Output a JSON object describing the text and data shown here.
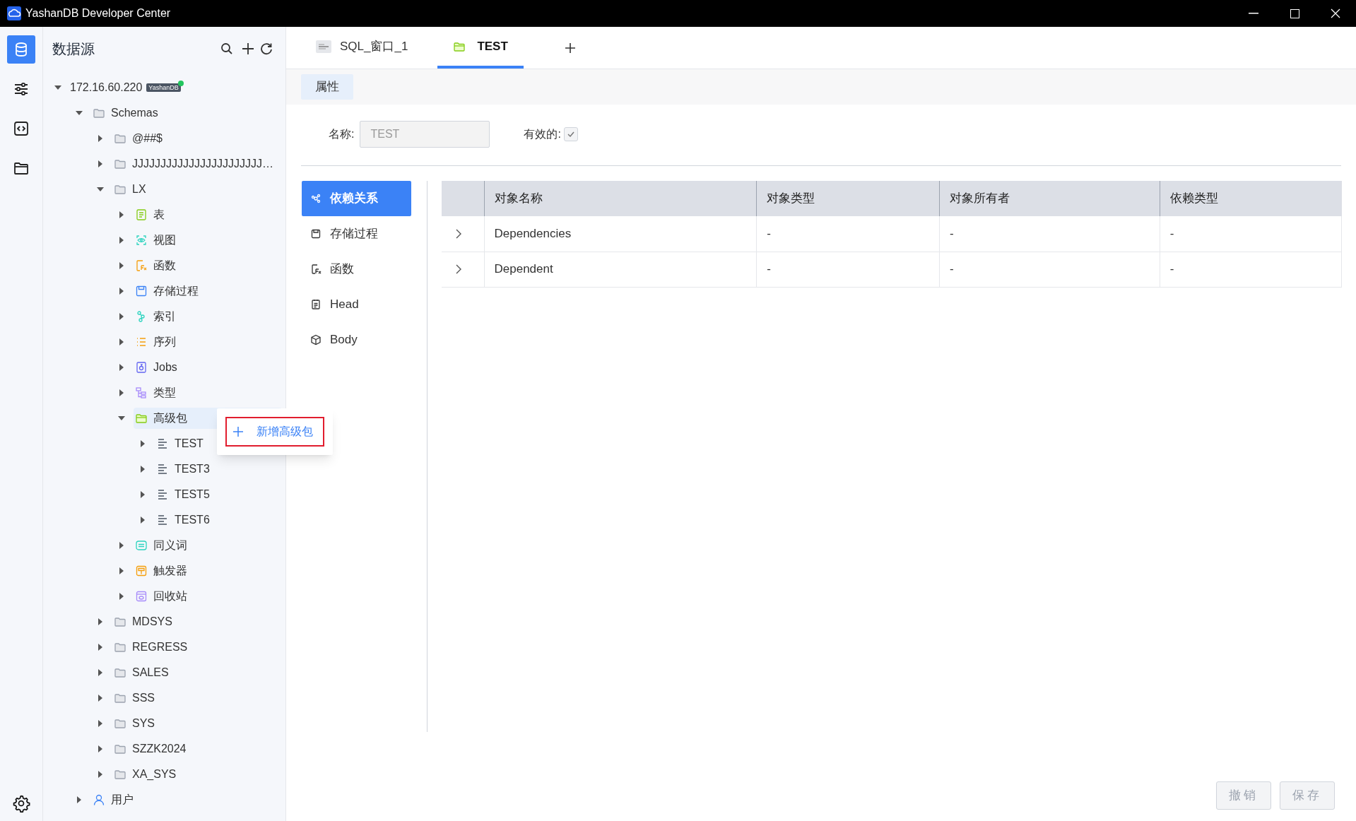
{
  "window": {
    "title": "YashanDB Developer Center"
  },
  "rail": [
    {
      "kind": "database",
      "selected": true
    },
    {
      "kind": "sliders",
      "selected": false
    },
    {
      "kind": "code",
      "selected": false
    },
    {
      "kind": "folder",
      "selected": false
    }
  ],
  "sidebar": {
    "title": "数据源",
    "tree": [
      {
        "label": "172.16.60.220",
        "badge": "YashanDB",
        "online": true,
        "expanded": true,
        "selected": false,
        "children": [
          {
            "label": "Schemas",
            "kind": "folder",
            "expanded": true,
            "selected": false,
            "children": [
              {
                "label": "@##$",
                "kind": "folder",
                "expanded": false,
                "selected": false
              },
              {
                "label": "JJJJJJJJJJJJJJJJJJJJJJJ…",
                "kind": "folder",
                "expanded": false,
                "selected": false
              },
              {
                "label": "LX",
                "kind": "folder",
                "expanded": true,
                "selected": false,
                "children": [
                  {
                    "label": "表",
                    "kind": "table",
                    "expanded": false,
                    "selected": false
                  },
                  {
                    "label": "视图",
                    "kind": "view",
                    "expanded": false,
                    "selected": false
                  },
                  {
                    "label": "函数",
                    "kind": "function",
                    "expanded": false,
                    "selected": false
                  },
                  {
                    "label": "存储过程",
                    "kind": "procedure",
                    "expanded": false,
                    "selected": false
                  },
                  {
                    "label": "索引",
                    "kind": "index",
                    "expanded": false,
                    "selected": false
                  },
                  {
                    "label": "序列",
                    "kind": "sequence",
                    "expanded": false,
                    "selected": false
                  },
                  {
                    "label": "Jobs",
                    "kind": "job",
                    "expanded": false,
                    "selected": false
                  },
                  {
                    "label": "类型",
                    "kind": "type",
                    "expanded": false,
                    "selected": false
                  },
                  {
                    "label": "高级包",
                    "kind": "packages",
                    "expanded": true,
                    "selected": true,
                    "children": [
                      {
                        "label": "TEST",
                        "kind": "package",
                        "expanded": false,
                        "selected": false
                      },
                      {
                        "label": "TEST3",
                        "kind": "package",
                        "expanded": false,
                        "selected": false
                      },
                      {
                        "label": "TEST5",
                        "kind": "package",
                        "expanded": false,
                        "selected": false
                      },
                      {
                        "label": "TEST6",
                        "kind": "package",
                        "expanded": false,
                        "selected": false
                      }
                    ]
                  },
                  {
                    "label": "同义词",
                    "kind": "synonym",
                    "expanded": false,
                    "selected": false
                  },
                  {
                    "label": "触发器",
                    "kind": "trigger",
                    "expanded": false,
                    "selected": false
                  },
                  {
                    "label": "回收站",
                    "kind": "recycle",
                    "expanded": false,
                    "selected": false
                  }
                ]
              },
              {
                "label": "MDSYS",
                "kind": "folder",
                "expanded": false,
                "selected": false
              },
              {
                "label": "REGRESS",
                "kind": "folder",
                "expanded": false,
                "selected": false
              },
              {
                "label": "SALES",
                "kind": "folder",
                "expanded": false,
                "selected": false
              },
              {
                "label": "SSS",
                "kind": "folder",
                "expanded": false,
                "selected": false
              },
              {
                "label": "SYS",
                "kind": "folder",
                "expanded": false,
                "selected": false
              },
              {
                "label": "SZZK2024",
                "kind": "folder",
                "expanded": false,
                "selected": false
              },
              {
                "label": "XA_SYS",
                "kind": "folder",
                "expanded": false,
                "selected": false
              }
            ]
          },
          {
            "label": "用户",
            "kind": "user",
            "expanded": false,
            "selected": false
          }
        ]
      }
    ]
  },
  "context_menu": {
    "items": [
      {
        "label": "新增高级包",
        "highlighted": true
      }
    ]
  },
  "tabs": [
    {
      "label": "SQL_窗口_1",
      "kind": "sql",
      "selected": false
    },
    {
      "label": "TEST",
      "kind": "package",
      "selected": true
    }
  ],
  "subtabs": [
    {
      "label": "属性",
      "selected": true
    }
  ],
  "form": {
    "name_label": "名称:",
    "name_value": "TEST",
    "name_disabled": true,
    "valid_label": "有效的:",
    "valid_checked": true
  },
  "nav": [
    {
      "label": "依赖关系",
      "kind": "deps",
      "selected": true
    },
    {
      "label": "存储过程",
      "kind": "procedure",
      "selected": false
    },
    {
      "label": "函数",
      "kind": "function",
      "selected": false
    },
    {
      "label": "Head",
      "kind": "head",
      "selected": false
    },
    {
      "label": "Body",
      "kind": "body",
      "selected": false
    }
  ],
  "table": {
    "columns": [
      "对象名称",
      "对象类型",
      "对象所有者",
      "依赖类型"
    ],
    "rows": [
      {
        "cells": [
          "Dependencies",
          "-",
          "-",
          "-"
        ],
        "expanded": false
      },
      {
        "cells": [
          "Dependent",
          "-",
          "-",
          "-"
        ],
        "expanded": false
      }
    ]
  },
  "buttons": [
    {
      "label": "撤销",
      "disabled": true
    },
    {
      "label": "保存",
      "disabled": true
    }
  ]
}
